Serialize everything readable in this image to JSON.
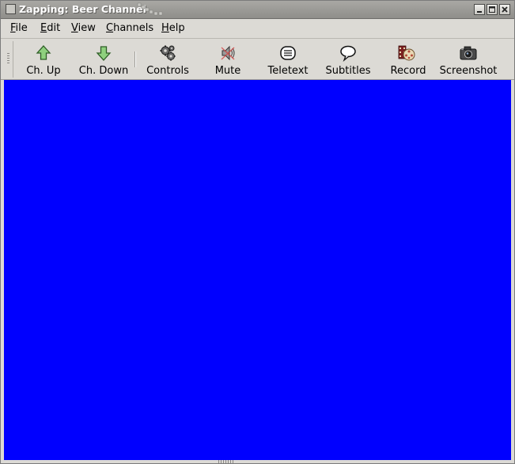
{
  "window": {
    "title": "Zapping: Beer Channel"
  },
  "menubar": {
    "items": [
      {
        "key": "F",
        "rest": "ile"
      },
      {
        "key": "E",
        "rest": "dit"
      },
      {
        "key": "V",
        "rest": "iew"
      },
      {
        "key": "C",
        "rest": "hannels"
      },
      {
        "key": "H",
        "rest": "elp"
      }
    ]
  },
  "toolbar": {
    "buttons": [
      {
        "label": "Ch. Up",
        "icon": "arrow-up-icon"
      },
      {
        "label": "Ch. Down",
        "icon": "arrow-down-icon"
      },
      {
        "label": "Controls",
        "icon": "gears-icon"
      },
      {
        "label": "Mute",
        "icon": "speaker-muted-icon"
      },
      {
        "label": "Teletext",
        "icon": "teletext-icon"
      },
      {
        "label": "Subtitles",
        "icon": "speech-bubble-icon"
      },
      {
        "label": "Record",
        "icon": "film-reel-icon"
      },
      {
        "label": "Screenshot",
        "icon": "camera-icon"
      }
    ]
  },
  "video": {
    "color": "#0000ff"
  }
}
